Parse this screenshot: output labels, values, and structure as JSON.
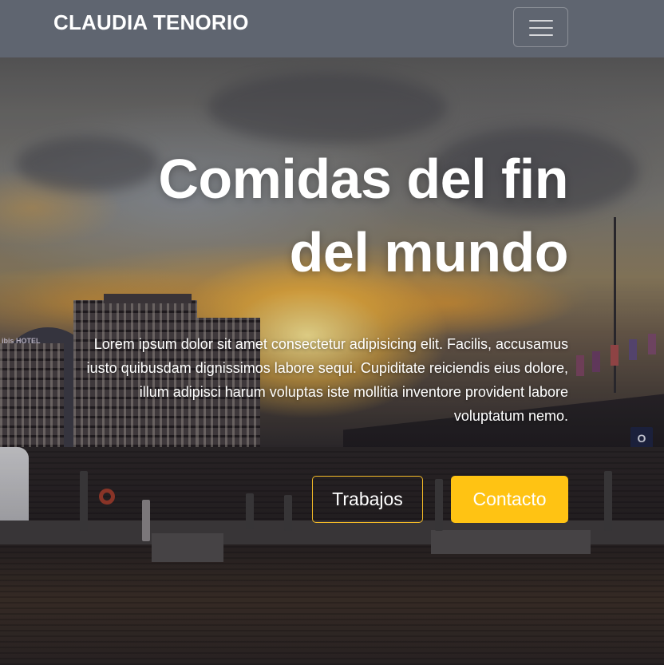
{
  "navbar": {
    "brand": "CLAUDIA TENORIO",
    "toggler_icon": "hamburger-menu-icon"
  },
  "hero": {
    "title_line1": "Comidas del fin",
    "title_line2": "del mundo",
    "description": "Lorem ipsum dolor sit amet consectetur adipisicing elit. Facilis, accusamus iusto quibusdam dignissimos labore sequi. Cupiditate reiciendis eius dolore, illum adipisci harum voluptas iste mollitia inventore provident labore voluptatum nemo.",
    "buttons": {
      "primary_label": "Trabajos",
      "secondary_label": "Contacto"
    }
  },
  "background": {
    "sign_text": "OPEN",
    "hotel_sign": "ibis HOTEL"
  },
  "colors": {
    "navbar": "#5f6570",
    "accent": "#ffc313",
    "text": "#ffffff"
  }
}
